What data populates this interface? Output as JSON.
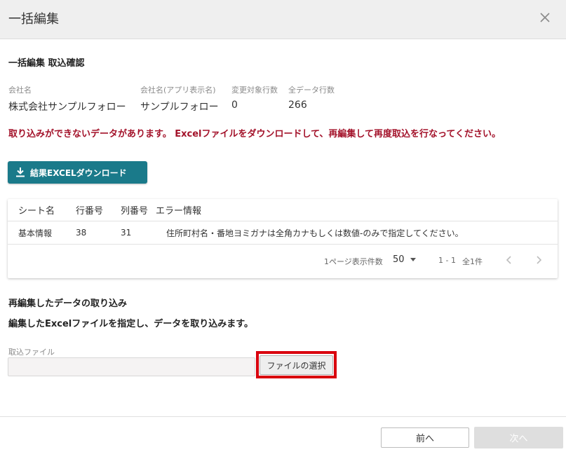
{
  "dialog": {
    "title": "一括編集"
  },
  "section": {
    "title": "一括編集 取込確認"
  },
  "info": [
    {
      "label": "会社名",
      "value": "株式会社サンプルフォロー"
    },
    {
      "label": "会社名(アプリ表示名)",
      "value": "サンプルフォロー"
    },
    {
      "label": "変更対象行数",
      "value": "0"
    },
    {
      "label": "全データ行数",
      "value": "266"
    }
  ],
  "error_message": "取り込みができないデータがあります。 Excelファイルをダウンロードして、再編集して再度取込を行なってください。",
  "download_button": {
    "label": "結果EXCELダウンロード"
  },
  "table": {
    "headers": [
      "シート名",
      "行番号",
      "列番号",
      "エラー情報"
    ],
    "rows": [
      {
        "sheet": "基本情報",
        "row": "38",
        "col": "31",
        "error": "住所町村名・番地ヨミガナは全角カナもしくは数値-のみで指定してください。"
      }
    ],
    "pager": {
      "per_page_label": "1ページ表示件数",
      "per_page_value": "50",
      "range": "1 - 1",
      "total": "全1件"
    }
  },
  "reimport": {
    "title": "再編集したデータの取り込み",
    "description": "編集したExcelファイルを指定し、データを取り込みます。",
    "file_label": "取込ファイル",
    "file_button": "ファイルの選択"
  },
  "footer": {
    "prev_label": "前へ",
    "next_label": "次へ"
  },
  "colors": {
    "accent": "#1a7a8a",
    "error": "#a3122a",
    "highlight": "#d9000d"
  }
}
